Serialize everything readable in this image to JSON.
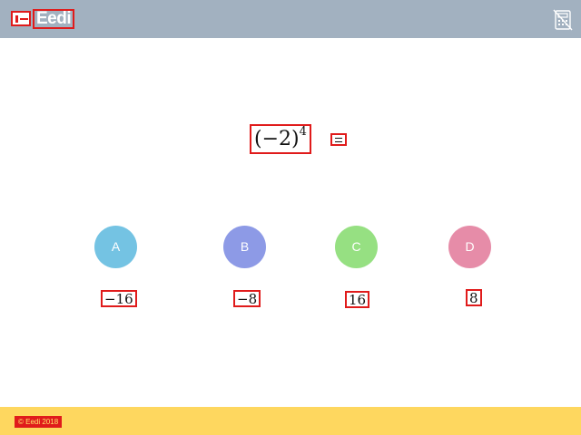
{
  "header": {
    "logo_text": "Eedi",
    "background": "#a2b1c0",
    "calculator_icon": "calculator-disabled-icon"
  },
  "question": {
    "base": "(−2)",
    "exponent": "4"
  },
  "options": [
    {
      "letter": "A",
      "answer": "−16",
      "color": "#74c3e3"
    },
    {
      "letter": "B",
      "answer": "−8",
      "color": "#8d9ae6"
    },
    {
      "letter": "C",
      "answer": "16",
      "color": "#96e082"
    },
    {
      "letter": "D",
      "answer": "8",
      "color": "#e68ca8"
    }
  ],
  "footer": {
    "copyright": "© Eedi 2018",
    "background": "#fed75f"
  }
}
